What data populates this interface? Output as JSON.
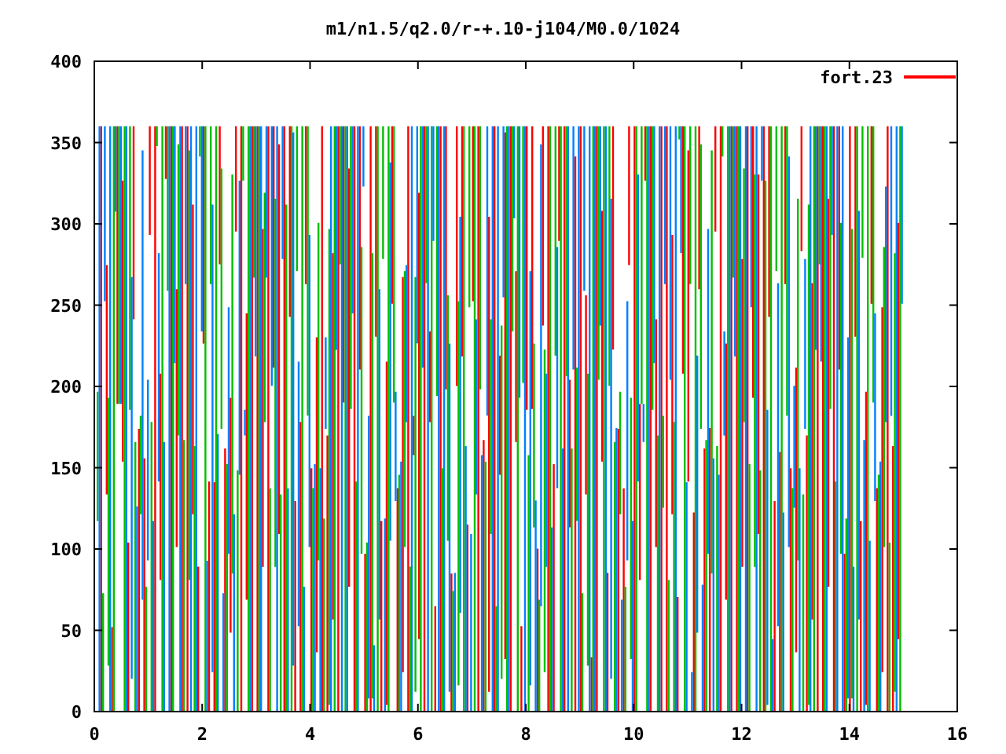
{
  "title": "m1/n1.5/q2.0/r-+.10-j104/M0.0/1024",
  "legend": {
    "label": "fort.23",
    "color": "#ff0000"
  },
  "traces": [
    {
      "color": "#ff0000"
    },
    {
      "color": "#00c000"
    },
    {
      "color": "#0080ff"
    }
  ],
  "yticks": [
    "400",
    "350",
    "300",
    "250",
    "200",
    "150",
    "100",
    "50",
    "0"
  ],
  "xticks": [
    "0",
    "2",
    "4",
    "6",
    "8",
    "10",
    "12",
    "14",
    "16"
  ]
}
